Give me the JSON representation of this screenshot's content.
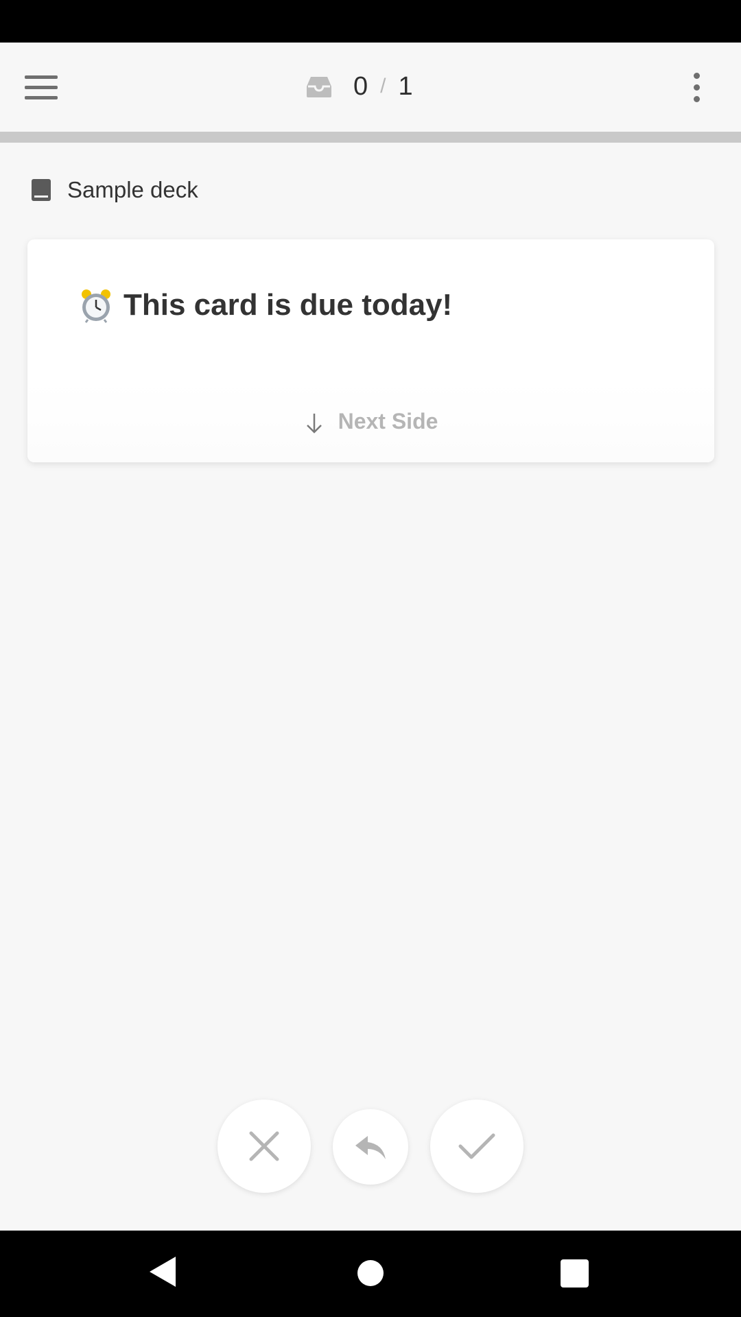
{
  "header": {
    "reviewed_count": "0",
    "separator": "/",
    "total_count": "1",
    "progress_fraction": 0
  },
  "deck": {
    "name": "Sample deck"
  },
  "card": {
    "title": "This card is due today!",
    "next_side_label": "Next Side"
  },
  "icons": {
    "menu": "hamburger-icon",
    "inbox": "inbox-icon",
    "more": "more-vert-icon",
    "deck": "book-icon",
    "card": "alarm-clock-icon",
    "next": "arrow-down-icon",
    "wrong": "close-icon",
    "undo": "reply-icon",
    "correct": "check-icon"
  },
  "colors": {
    "background": "#f7f7f7",
    "icon_gray": "#6f6f6f",
    "muted_gray": "#b5b5b5",
    "text": "#333333"
  }
}
